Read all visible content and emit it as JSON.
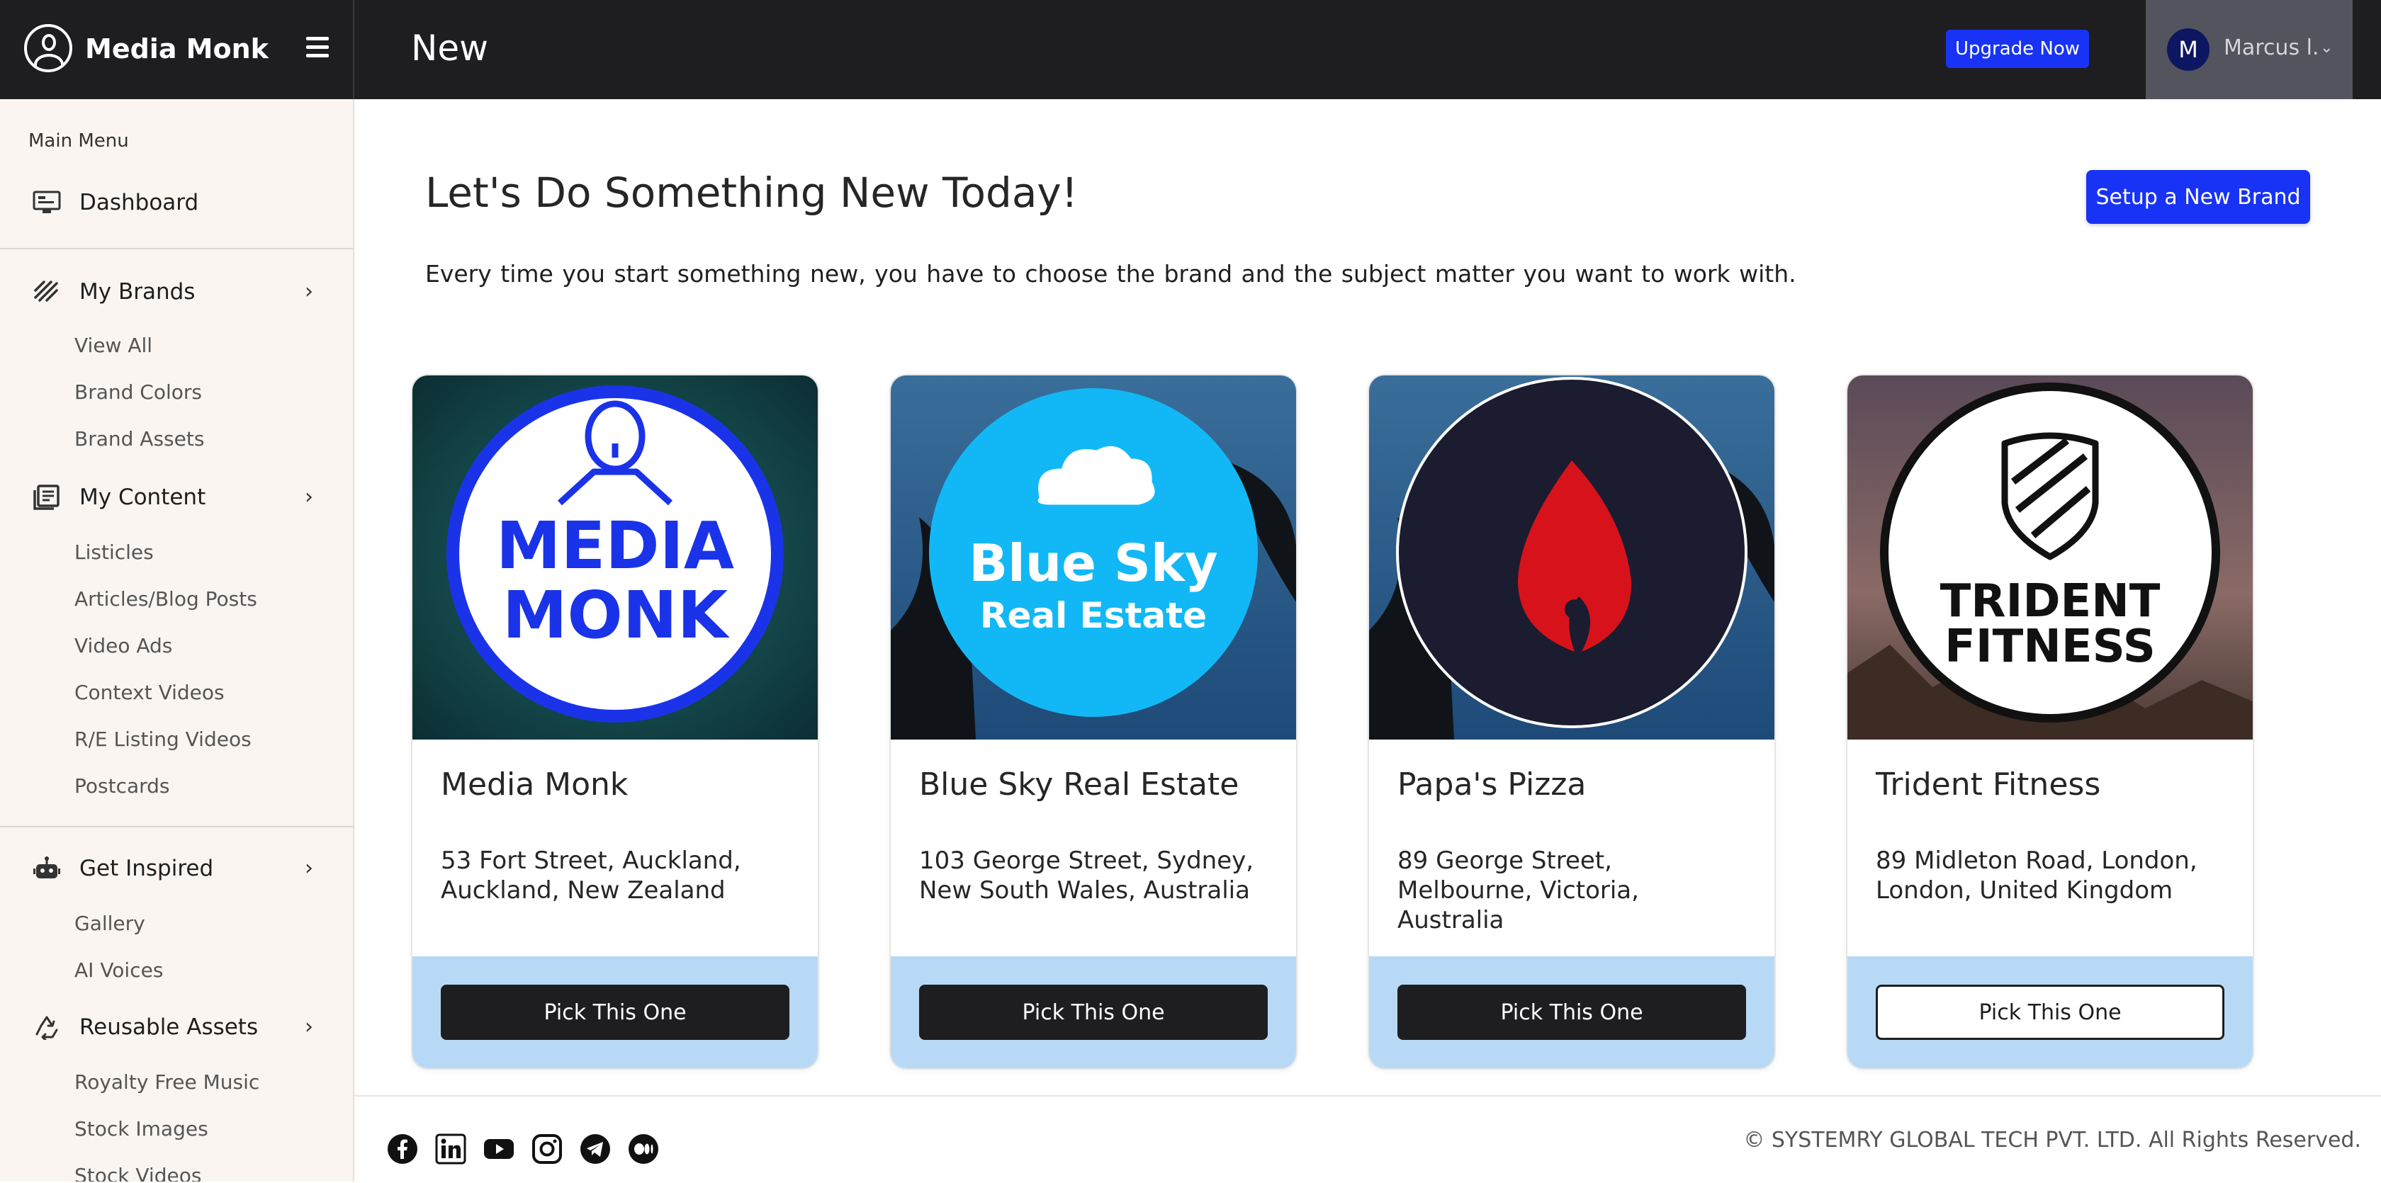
{
  "app": {
    "name": "Media Monk",
    "page_title": "New"
  },
  "header": {
    "upgrade_label": "Upgrade Now",
    "user": {
      "initial": "M",
      "name": "Marcus l.",
      "caret": "⌄"
    }
  },
  "sidebar": {
    "heading": "Main Menu",
    "dashboard": {
      "label": "Dashboard",
      "icon": "dashboard-icon"
    },
    "my_brands": {
      "label": "My Brands",
      "icon": "brands-icon",
      "items": [
        "View All",
        "Brand Colors",
        "Brand Assets"
      ]
    },
    "my_content": {
      "label": "My Content",
      "icon": "content-icon",
      "items": [
        "Listicles",
        "Articles/Blog Posts",
        "Video Ads",
        "Context Videos",
        "R/E Listing Videos",
        "Postcards"
      ]
    },
    "get_inspired": {
      "label": "Get Inspired",
      "icon": "robot-icon",
      "items": [
        "Gallery",
        "AI Voices"
      ]
    },
    "reusable_assets": {
      "label": "Reusable Assets",
      "icon": "recycle-icon",
      "items": [
        "Royalty Free Music",
        "Stock Images",
        "Stock Videos"
      ]
    }
  },
  "main": {
    "heading": "Let's Do Something New Today!",
    "subheading": "Every time you start something new, you have to choose the brand and the subject matter you want to work with.",
    "setup_label": "Setup a New Brand"
  },
  "brands": [
    {
      "name": "Media Monk",
      "address": "53 Fort Street, Auckland, Auckland, New Zealand",
      "button": "Pick This One",
      "logo_text": [
        "MEDIA",
        "MONK"
      ],
      "accent": "#1a33e8"
    },
    {
      "name": "Blue Sky Real Estate",
      "address": "103 George Street, Sydney, New South Wales, Australia",
      "button": "Pick This One",
      "logo_text": [
        "Blue Sky",
        "Real Estate"
      ],
      "accent": "#12b8f5"
    },
    {
      "name": "Papa's Pizza",
      "address": "89 George Street, Melbourne, Victoria, Australia",
      "button": "Pick This One",
      "logo_text": [],
      "accent": "#d8121b"
    },
    {
      "name": "Trident Fitness",
      "address": "89 Midleton Road, London, London, United Kingdom",
      "button": "Pick This One",
      "logo_text": [
        "TRIDENT",
        "FITNESS"
      ],
      "accent": "#111111"
    }
  ],
  "footer": {
    "social": [
      "facebook-icon",
      "linkedin-icon",
      "youtube-icon",
      "instagram-icon",
      "telegram-icon",
      "medium-icon"
    ],
    "copyright": "© SYSTEMRY GLOBAL TECH PVT. LTD. All Rights Reserved."
  }
}
